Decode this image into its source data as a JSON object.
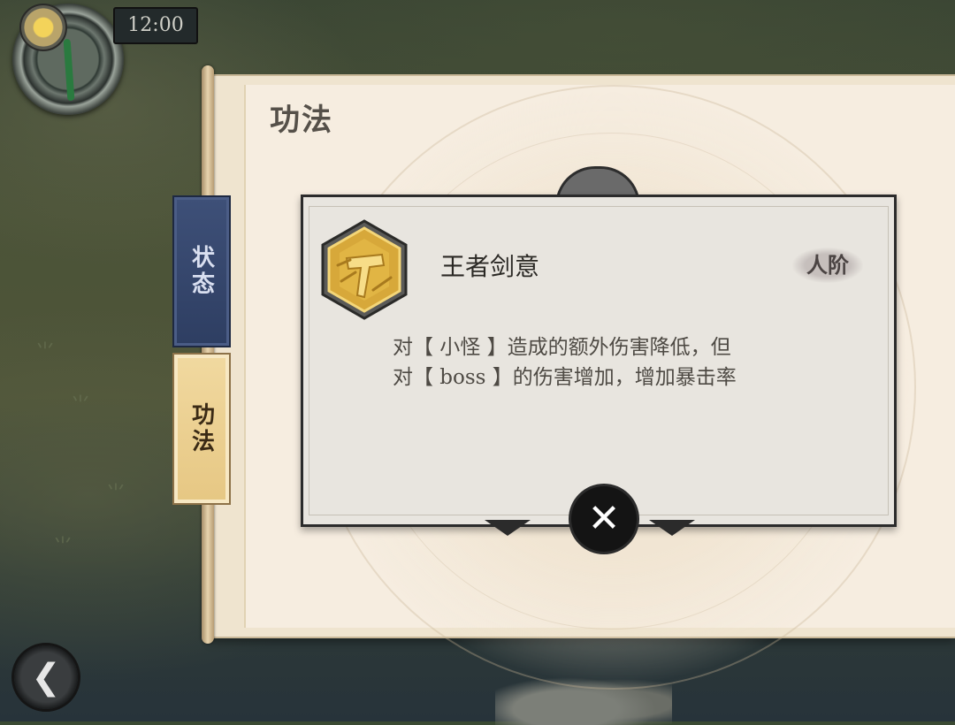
{
  "hud": {
    "time": "12:00",
    "icons": {
      "sun": "sun-icon",
      "compass": "compass-icon"
    }
  },
  "panel": {
    "title": "功法",
    "tabs": [
      {
        "label": "状态",
        "active": false,
        "color": "#3e5078"
      },
      {
        "label": "功法",
        "active": true,
        "color": "#f1d9a0"
      }
    ]
  },
  "skill": {
    "name": "王者剑意",
    "rank": "人阶",
    "icon": "hammer-skill-icon",
    "description_line1": "对【 小怪 】造成的额外伤害降低，但",
    "description_line2": "对【 boss 】的伤害增加，增加暴击率"
  },
  "buttons": {
    "close_icon": "close-icon",
    "back_icon": "back-arrow-icon"
  },
  "colors": {
    "scroll_paper": "#efe4cf",
    "popup_bg": "#e8e5df",
    "gold": "#d7a83a"
  }
}
